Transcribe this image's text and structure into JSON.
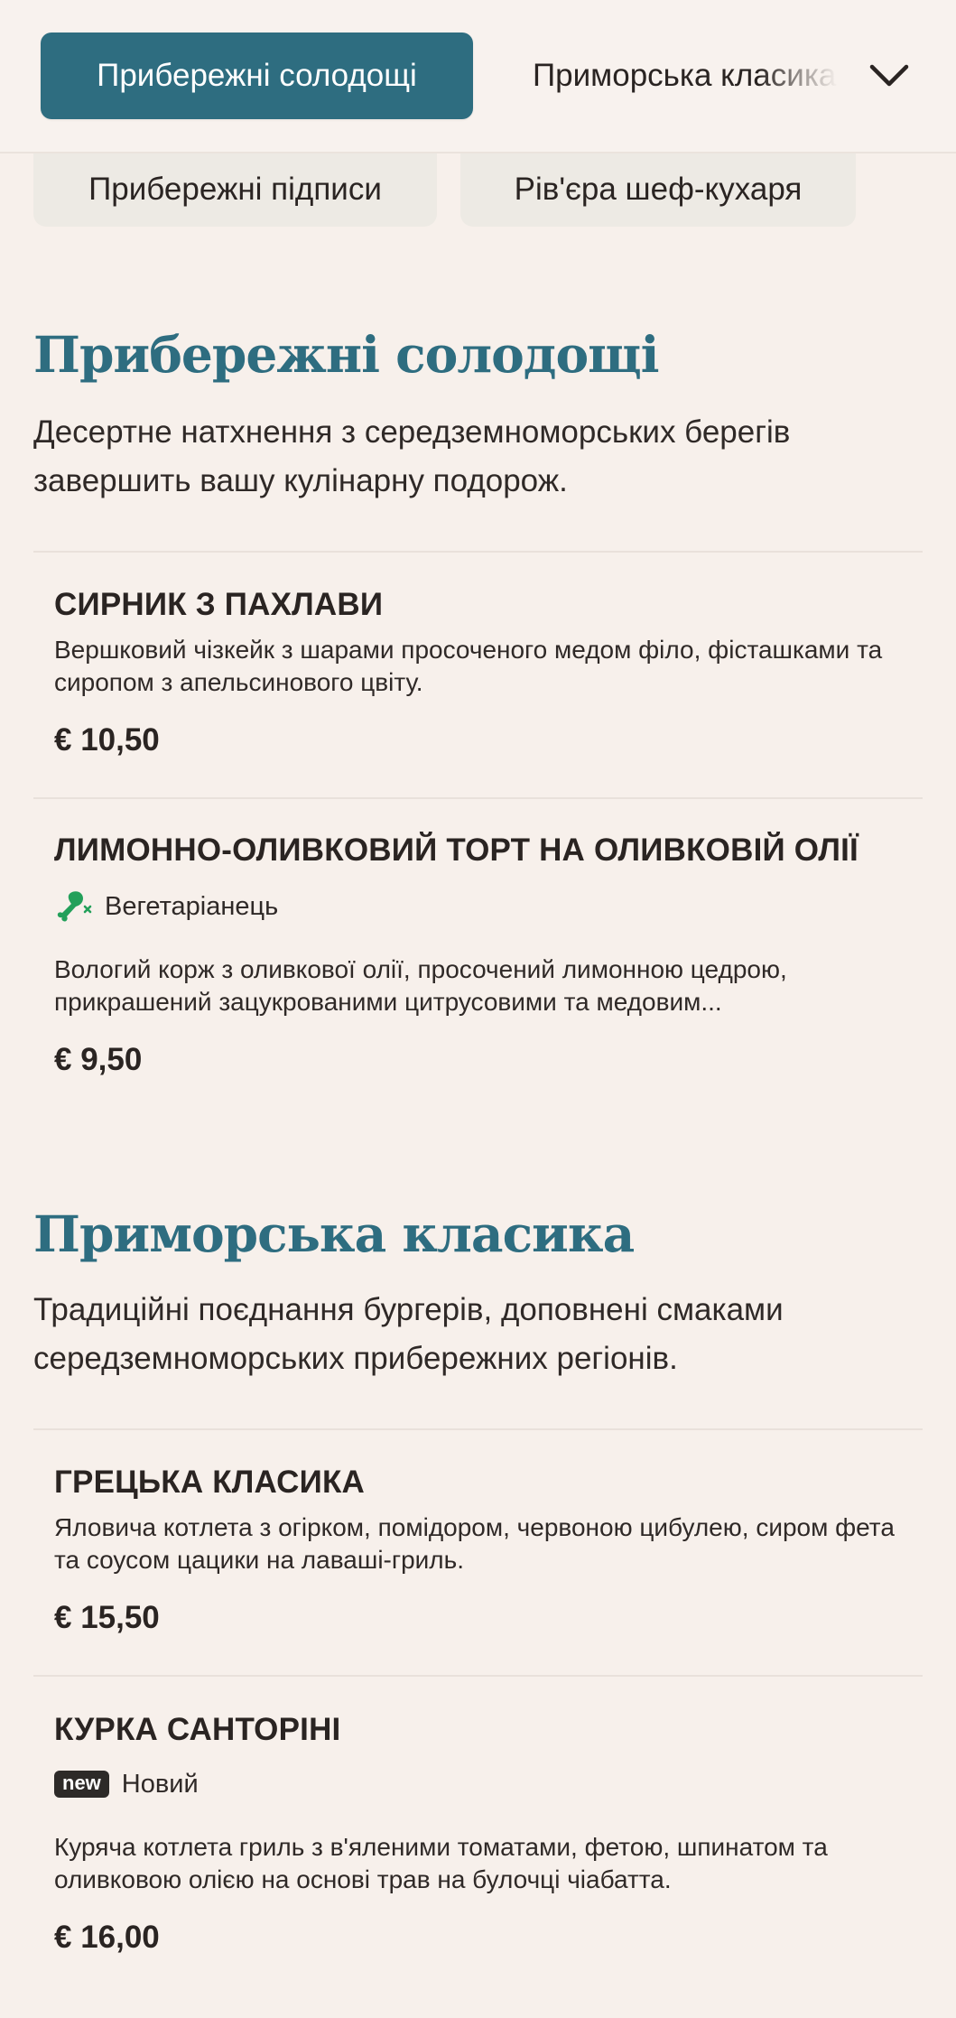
{
  "nav": {
    "active_tab": "Прибережні солодощі",
    "next_tab": "Приморська класика",
    "expand_icon": "chevron-down-icon",
    "secondary_tabs": [
      "Прибережні підписи",
      "Рів'єра шеф-кухаря"
    ]
  },
  "colors": {
    "accent": "#2e6d80",
    "background": "#f7f0eb",
    "vegetarian_green": "#23a05a",
    "badge_dark": "#2d2a28"
  },
  "sections": [
    {
      "title": "Прибережні солодощі",
      "description": "Десертне натхнення з середземноморських берегів завершить вашу кулінарну подорож.",
      "items": [
        {
          "name": "СИРНИК З ПАХЛАВИ",
          "description": "Вершковий чізкейк з шарами просоченого медом філо, фісташками та сиропом з апельсинового цвіту.",
          "price": "€ 10,50"
        },
        {
          "name": "ЛИМОННО-ОЛИВКОВИЙ ТОРТ НА ОЛИВКОВІЙ ОЛІЇ",
          "tag": "Вегетаріанець",
          "tag_icon": "vegetarian-leg-icon",
          "description": "Вологий корж з оливкової олії, просочений лимонною цедрою, прикрашений зацукрованими цитрусовими та медовим...",
          "price": "€ 9,50"
        }
      ]
    },
    {
      "title": "Приморська класика",
      "description": "Традиційні поєднання бургерів, доповнені смаками середземноморських прибережних регіонів.",
      "items": [
        {
          "name": "ГРЕЦЬКА КЛАСИКА",
          "description": "Яловича котлета з огірком, помідором, червоною цибулею, сиром фета та соусом цацики на лаваші-гриль.",
          "price": "€ 15,50"
        },
        {
          "name": "КУРКА САНТОРІНІ",
          "badge": "new",
          "tag": "Новий",
          "description": "Куряча котлета гриль з в'яленими томатами, фетою, шпинатом та оливковою олією на основі трав на булочці чіабатта.",
          "price": "€ 16,00"
        }
      ]
    }
  ]
}
